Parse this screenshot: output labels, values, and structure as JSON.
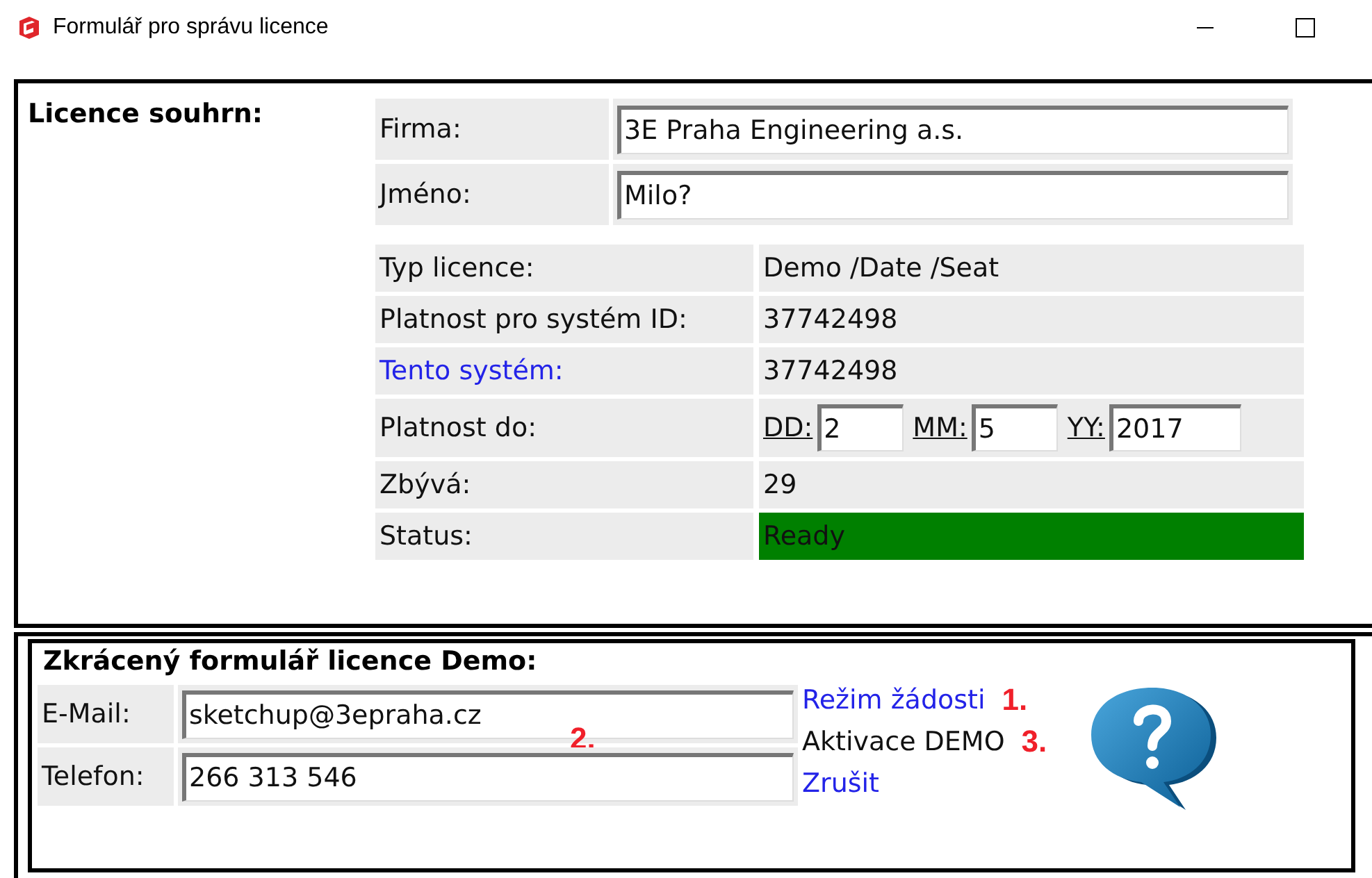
{
  "window": {
    "title": "Formulář pro správu licence"
  },
  "summary": {
    "heading": "Licence souhrn:",
    "fields": [
      {
        "label": "Firma:",
        "value": "3E Praha Engineering a.s."
      },
      {
        "label": "Jméno:",
        "value": "Milo?"
      }
    ],
    "rows": [
      {
        "kind": "text",
        "label": "Typ licence:",
        "value": "Demo /Date /Seat"
      },
      {
        "kind": "text",
        "label": "Platnost pro systém ID:",
        "value": "37742498"
      },
      {
        "kind": "link",
        "label": "Tento systém:",
        "value": "37742498"
      },
      {
        "kind": "date",
        "label": "Platnost do:",
        "parts": [
          {
            "label": "DD:",
            "value": "2"
          },
          {
            "label": "MM:",
            "value": "5"
          },
          {
            "label": "YY:",
            "value": "2017"
          }
        ]
      },
      {
        "kind": "text",
        "label": "Zbývá:",
        "value": "29"
      },
      {
        "kind": "status",
        "label": "Status:",
        "value": "Ready",
        "color": "#008000"
      }
    ]
  },
  "demo": {
    "heading": "Zkrácený formulář licence Demo:",
    "fields": [
      {
        "label": "E-Mail:",
        "value": "sketchup@3epraha.cz",
        "marker": "2."
      },
      {
        "label": "Telefon:",
        "value": "266 313 546"
      }
    ],
    "actions": [
      {
        "kind": "link",
        "label": "Režim žádosti",
        "marker": "1."
      },
      {
        "kind": "text",
        "label": "Aktivace DEMO",
        "marker": "3."
      },
      {
        "kind": "link",
        "label": "Zrušit"
      }
    ]
  }
}
